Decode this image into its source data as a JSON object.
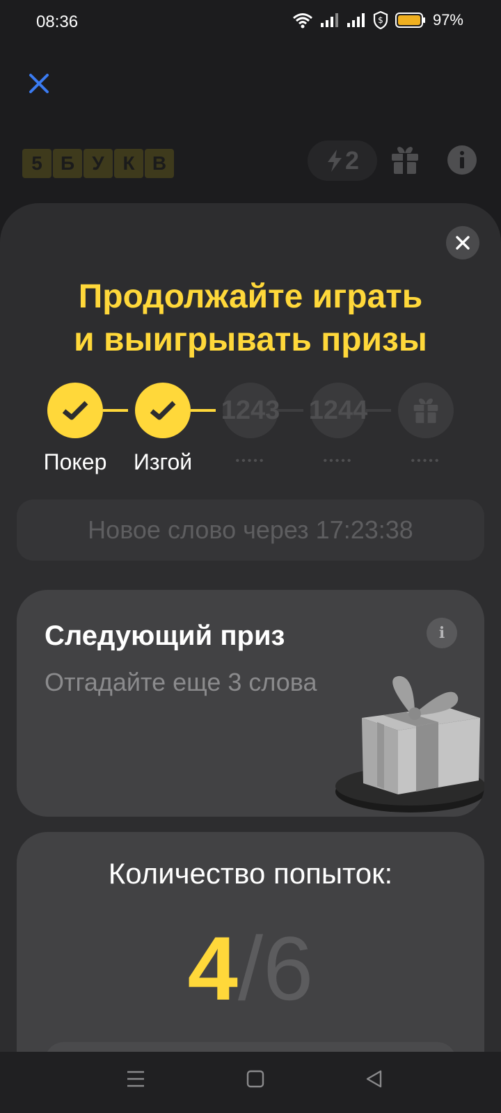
{
  "status_bar": {
    "time": "08:36",
    "battery_percent": "97%",
    "icons": [
      "wifi-icon",
      "signal-icon",
      "signal-icon",
      "shield-dollar-icon",
      "battery-icon"
    ]
  },
  "header": {
    "logo_letters": [
      "5",
      "Б",
      "У",
      "К",
      "В"
    ],
    "energy_count": "2",
    "icons": [
      "close-icon",
      "lightning-icon",
      "gift-icon",
      "info-icon"
    ]
  },
  "sheet": {
    "headline_line1": "Продолжайте играть",
    "headline_line2": "и выигрывать призы",
    "steps": [
      {
        "state": "done",
        "label": "Покер"
      },
      {
        "state": "done",
        "label": "Изгой"
      },
      {
        "state": "todo",
        "number": "1243",
        "dots": "•••••"
      },
      {
        "state": "todo",
        "number": "1244",
        "dots": "•••••"
      },
      {
        "state": "gift",
        "dots": "•••••"
      }
    ],
    "timer_text": "Новое слово через 17:23:38",
    "prize": {
      "title": "Следующий приз",
      "subtitle": "Отгадайте еще 3 слова",
      "info_glyph": "i"
    },
    "tries": {
      "title": "Количество попыток:",
      "used": "4",
      "separator": "/",
      "total": "6"
    }
  },
  "colors": {
    "accent": "#ffd83a",
    "background": "#1c1c1e",
    "sheet": "#2d2d2f",
    "card": "#424244",
    "close_blue": "#3a7bf2"
  }
}
